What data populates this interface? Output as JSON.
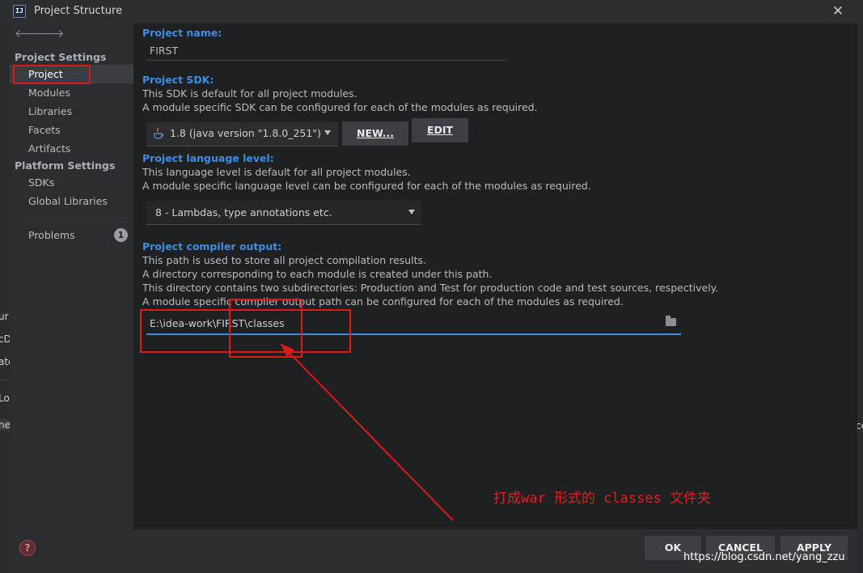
{
  "window": {
    "title": "Project Structure",
    "app_icon_label": "IJ"
  },
  "nav": {
    "back_icon": "back-arrow-icon",
    "forward_icon": "forward-arrow-icon"
  },
  "sidebar": {
    "project_settings_header": "Project Settings",
    "project_settings_items": [
      {
        "label": "Project",
        "selected": true
      },
      {
        "label": "Modules"
      },
      {
        "label": "Libraries"
      },
      {
        "label": "Facets"
      },
      {
        "label": "Artifacts"
      }
    ],
    "platform_settings_header": "Platform Settings",
    "platform_settings_items": [
      {
        "label": "SDKs"
      },
      {
        "label": "Global Libraries"
      }
    ],
    "problems_label": "Problems",
    "problems_count": "1"
  },
  "project": {
    "name_label": "Project name:",
    "name_value": "FIRST",
    "sdk_label": "Project SDK:",
    "sdk_desc1": "This SDK is default for all project modules.",
    "sdk_desc2": "A module specific SDK can be configured for each of the modules as required.",
    "sdk_value": "1.8 (java version \"1.8.0_251\")",
    "new_button": "NEW...",
    "edit_button": "EDIT",
    "lang_label": "Project language level:",
    "lang_desc1": "This language level is default for all project modules.",
    "lang_desc2": "A module specific language level can be configured for each of the modules as required.",
    "lang_value": "8 - Lambdas, type annotations etc.",
    "output_label": "Project compiler output:",
    "output_desc1": "This path is used to store all project compilation results.",
    "output_desc2": "A directory corresponding to each module is created under this path.",
    "output_desc3": "This directory contains two subdirectories: Production and Test for production code and test sources, respectively.",
    "output_desc4": "A module specific compiler output path can be configured for each of the modules as required.",
    "output_path": "E:\\idea-work\\FIRST\\classes"
  },
  "annotation": {
    "text": "打成war 形式的 classes 文件夹",
    "color": "#e02020"
  },
  "footer": {
    "help_label": "?",
    "ok": "OK",
    "cancel": "CANCEL",
    "apply": "APPLY"
  },
  "watermark": "https://blog.csdn.net/yang_zzu",
  "background_fragments": {
    "left": [
      "ur",
      "cD",
      "ate",
      "Lo",
      "ne"
    ],
    "right": [
      "ce"
    ]
  },
  "colors": {
    "accent": "#3d8ee6",
    "annotation_red": "#e01818",
    "dialog_bg": "#1e2022",
    "sidebar_bg": "#2b2d30"
  }
}
